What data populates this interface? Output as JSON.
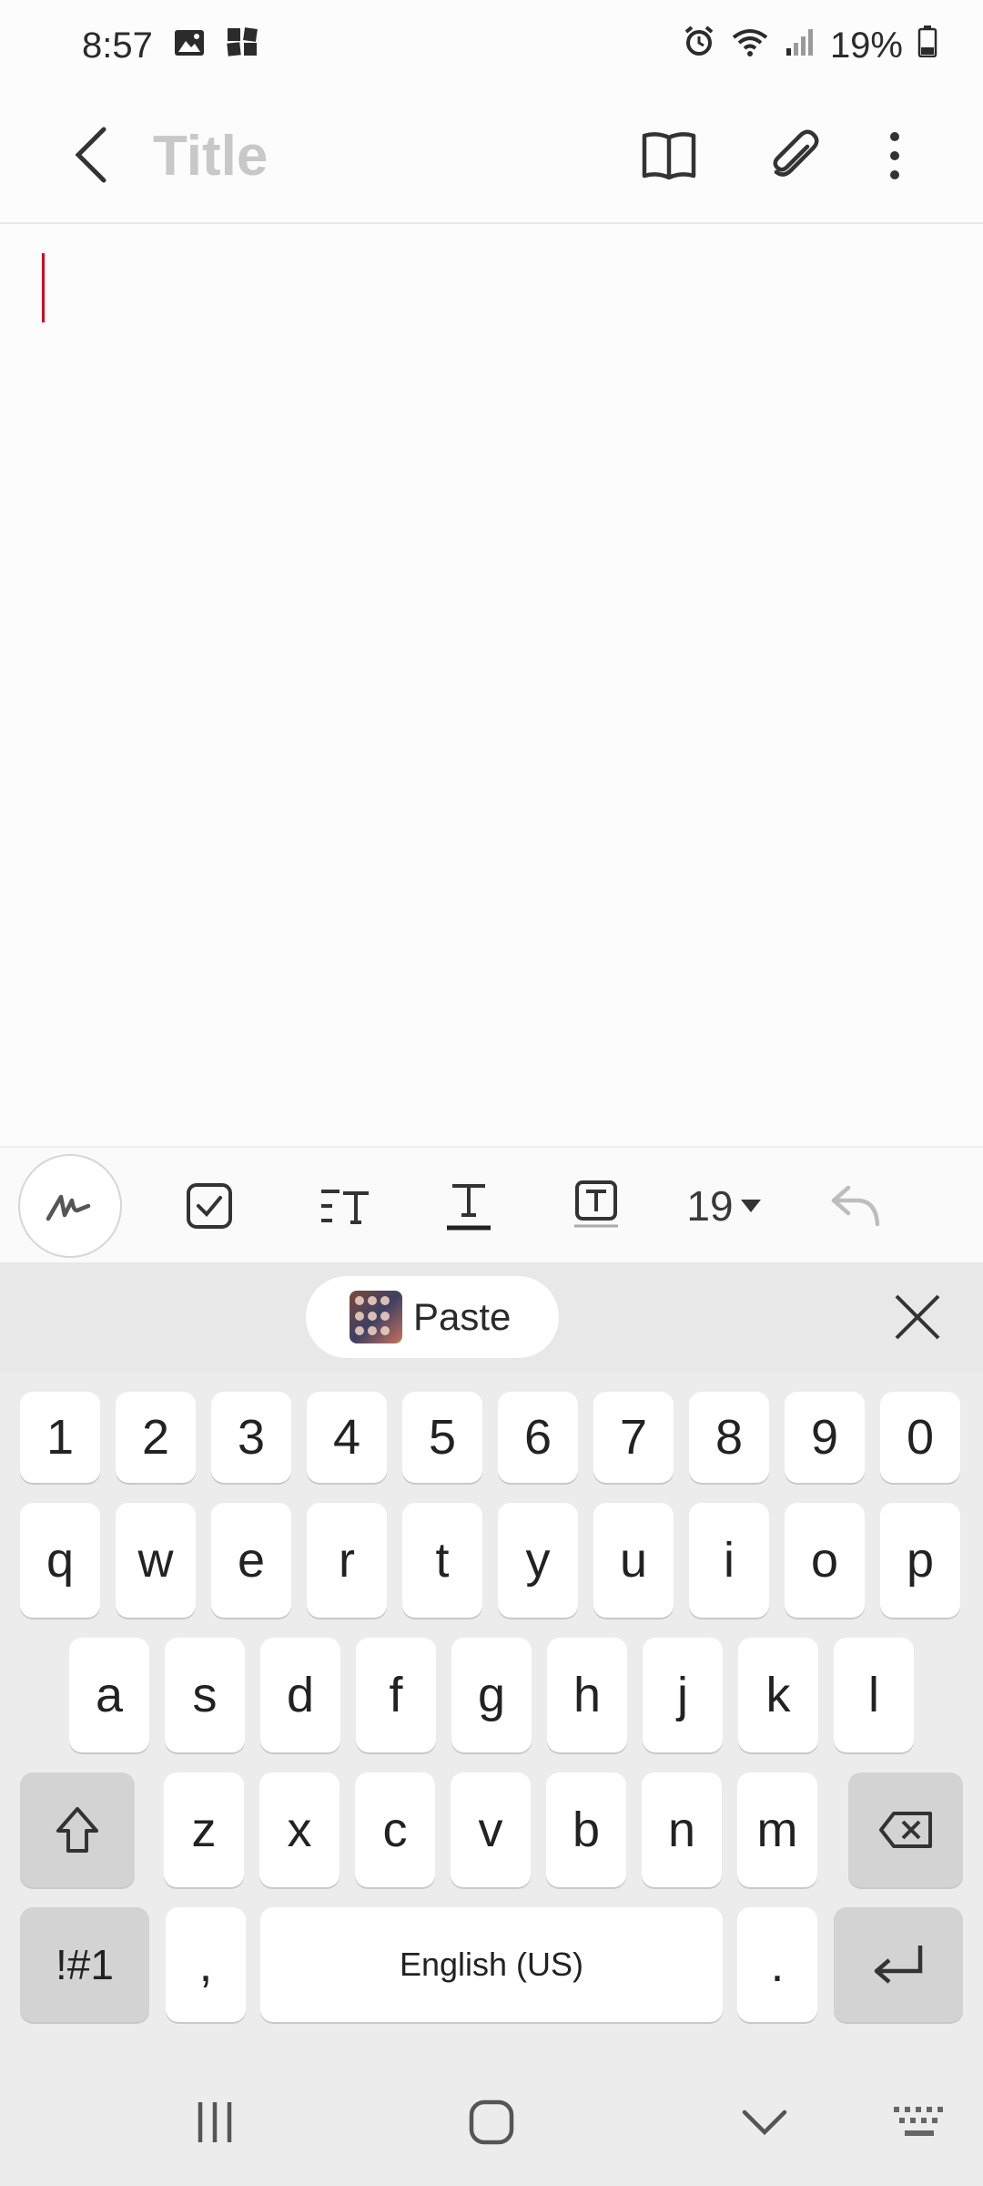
{
  "status_bar": {
    "time": "8:57",
    "battery": "19%"
  },
  "app_bar": {
    "title_placeholder": "Title"
  },
  "toolbar": {
    "font_size": "19"
  },
  "keyboard": {
    "paste_label": "Paste",
    "number_row": [
      "1",
      "2",
      "3",
      "4",
      "5",
      "6",
      "7",
      "8",
      "9",
      "0"
    ],
    "row1": [
      "q",
      "w",
      "e",
      "r",
      "t",
      "y",
      "u",
      "i",
      "o",
      "p"
    ],
    "row2": [
      "a",
      "s",
      "d",
      "f",
      "g",
      "h",
      "j",
      "k",
      "l"
    ],
    "row3": [
      "z",
      "x",
      "c",
      "v",
      "b",
      "n",
      "m"
    ],
    "symbols_label": "!#1",
    "comma": ",",
    "space_label": "English (US)",
    "period": "."
  },
  "colors": {
    "cursor": "#d1001c",
    "keyboard_bg": "#ececec",
    "key_bg": "#ffffff",
    "function_key_bg": "#d3d3d3"
  }
}
